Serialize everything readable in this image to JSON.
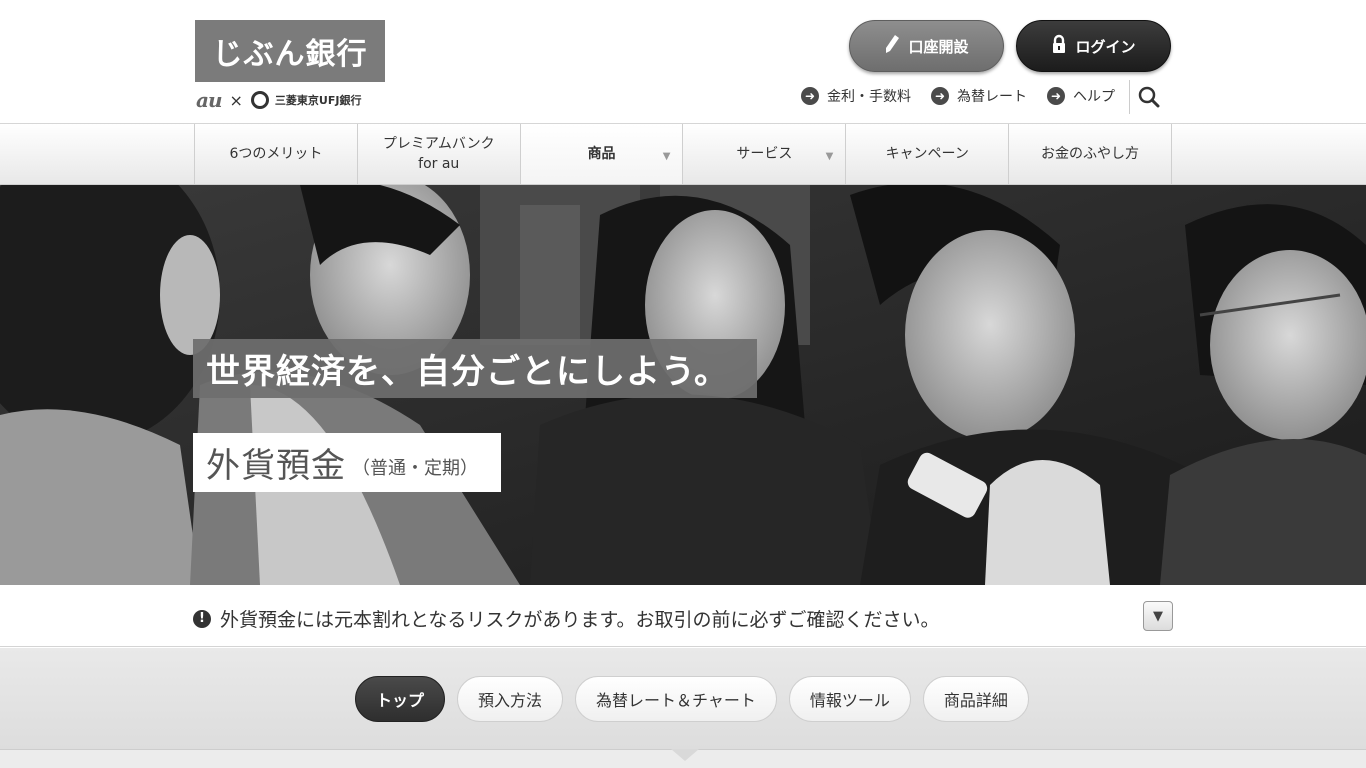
{
  "brand": {
    "logo_text": "じぶん銀行",
    "partner_au": "au",
    "partner_times": "×",
    "partner_bank": "三菱東京UFJ銀行"
  },
  "header": {
    "open_account_label": "口座開設",
    "login_label": "ログイン",
    "links": [
      {
        "label": "金利・手数料"
      },
      {
        "label": "為替レート"
      },
      {
        "label": "ヘルプ"
      }
    ]
  },
  "nav": {
    "items": [
      {
        "label": "6つのメリット",
        "label2": ""
      },
      {
        "label": "プレミアムバンク",
        "label2": "for au"
      },
      {
        "label": "商品",
        "label2": ""
      },
      {
        "label": "サービス",
        "label2": ""
      },
      {
        "label": "キャンペーン",
        "label2": ""
      },
      {
        "label": "お金のふやし方",
        "label2": ""
      }
    ]
  },
  "hero": {
    "catch": "世界経済を、自分ごとにしよう。",
    "product_main": "外貨預金",
    "product_sub": "（普通・定期）"
  },
  "risk": {
    "text": "外貨預金には元本割れとなるリスクがあります。お取引の前に必ずご確認ください。",
    "toggle_symbol": "▼"
  },
  "tabs": [
    {
      "label": "トップ"
    },
    {
      "label": "預入方法"
    },
    {
      "label": "為替レート＆チャート"
    },
    {
      "label": "情報ツール"
    },
    {
      "label": "商品詳細"
    }
  ]
}
